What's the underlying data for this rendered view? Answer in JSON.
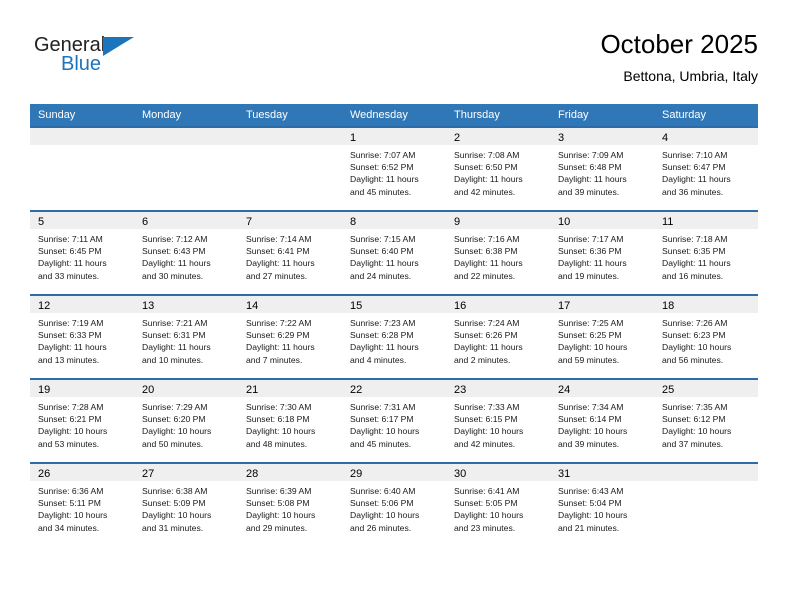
{
  "brand": {
    "name_top": "General",
    "name_bottom": "Blue",
    "accent_color": "#1c75bc",
    "text_color": "#231f20"
  },
  "header": {
    "title": "October 2025",
    "subtitle": "Bettona, Umbria, Italy"
  },
  "theme": {
    "header_row_background": "#3077b7",
    "cell_top_border": "#2c6ca8",
    "daynum_band_background": "#efefef",
    "cell_background": "#ffffff"
  },
  "weekdays": [
    "Sunday",
    "Monday",
    "Tuesday",
    "Wednesday",
    "Thursday",
    "Friday",
    "Saturday"
  ],
  "weeks": [
    [
      {
        "empty": true
      },
      {
        "empty": true
      },
      {
        "empty": true
      },
      {
        "day": "1",
        "sunrise": "Sunrise: 7:07 AM",
        "sunset": "Sunset: 6:52 PM",
        "daylight_1": "Daylight: 11 hours",
        "daylight_2": "and 45 minutes."
      },
      {
        "day": "2",
        "sunrise": "Sunrise: 7:08 AM",
        "sunset": "Sunset: 6:50 PM",
        "daylight_1": "Daylight: 11 hours",
        "daylight_2": "and 42 minutes."
      },
      {
        "day": "3",
        "sunrise": "Sunrise: 7:09 AM",
        "sunset": "Sunset: 6:48 PM",
        "daylight_1": "Daylight: 11 hours",
        "daylight_2": "and 39 minutes."
      },
      {
        "day": "4",
        "sunrise": "Sunrise: 7:10 AM",
        "sunset": "Sunset: 6:47 PM",
        "daylight_1": "Daylight: 11 hours",
        "daylight_2": "and 36 minutes."
      }
    ],
    [
      {
        "day": "5",
        "sunrise": "Sunrise: 7:11 AM",
        "sunset": "Sunset: 6:45 PM",
        "daylight_1": "Daylight: 11 hours",
        "daylight_2": "and 33 minutes."
      },
      {
        "day": "6",
        "sunrise": "Sunrise: 7:12 AM",
        "sunset": "Sunset: 6:43 PM",
        "daylight_1": "Daylight: 11 hours",
        "daylight_2": "and 30 minutes."
      },
      {
        "day": "7",
        "sunrise": "Sunrise: 7:14 AM",
        "sunset": "Sunset: 6:41 PM",
        "daylight_1": "Daylight: 11 hours",
        "daylight_2": "and 27 minutes."
      },
      {
        "day": "8",
        "sunrise": "Sunrise: 7:15 AM",
        "sunset": "Sunset: 6:40 PM",
        "daylight_1": "Daylight: 11 hours",
        "daylight_2": "and 24 minutes."
      },
      {
        "day": "9",
        "sunrise": "Sunrise: 7:16 AM",
        "sunset": "Sunset: 6:38 PM",
        "daylight_1": "Daylight: 11 hours",
        "daylight_2": "and 22 minutes."
      },
      {
        "day": "10",
        "sunrise": "Sunrise: 7:17 AM",
        "sunset": "Sunset: 6:36 PM",
        "daylight_1": "Daylight: 11 hours",
        "daylight_2": "and 19 minutes."
      },
      {
        "day": "11",
        "sunrise": "Sunrise: 7:18 AM",
        "sunset": "Sunset: 6:35 PM",
        "daylight_1": "Daylight: 11 hours",
        "daylight_2": "and 16 minutes."
      }
    ],
    [
      {
        "day": "12",
        "sunrise": "Sunrise: 7:19 AM",
        "sunset": "Sunset: 6:33 PM",
        "daylight_1": "Daylight: 11 hours",
        "daylight_2": "and 13 minutes."
      },
      {
        "day": "13",
        "sunrise": "Sunrise: 7:21 AM",
        "sunset": "Sunset: 6:31 PM",
        "daylight_1": "Daylight: 11 hours",
        "daylight_2": "and 10 minutes."
      },
      {
        "day": "14",
        "sunrise": "Sunrise: 7:22 AM",
        "sunset": "Sunset: 6:29 PM",
        "daylight_1": "Daylight: 11 hours",
        "daylight_2": "and 7 minutes."
      },
      {
        "day": "15",
        "sunrise": "Sunrise: 7:23 AM",
        "sunset": "Sunset: 6:28 PM",
        "daylight_1": "Daylight: 11 hours",
        "daylight_2": "and 4 minutes."
      },
      {
        "day": "16",
        "sunrise": "Sunrise: 7:24 AM",
        "sunset": "Sunset: 6:26 PM",
        "daylight_1": "Daylight: 11 hours",
        "daylight_2": "and 2 minutes."
      },
      {
        "day": "17",
        "sunrise": "Sunrise: 7:25 AM",
        "sunset": "Sunset: 6:25 PM",
        "daylight_1": "Daylight: 10 hours",
        "daylight_2": "and 59 minutes."
      },
      {
        "day": "18",
        "sunrise": "Sunrise: 7:26 AM",
        "sunset": "Sunset: 6:23 PM",
        "daylight_1": "Daylight: 10 hours",
        "daylight_2": "and 56 minutes."
      }
    ],
    [
      {
        "day": "19",
        "sunrise": "Sunrise: 7:28 AM",
        "sunset": "Sunset: 6:21 PM",
        "daylight_1": "Daylight: 10 hours",
        "daylight_2": "and 53 minutes."
      },
      {
        "day": "20",
        "sunrise": "Sunrise: 7:29 AM",
        "sunset": "Sunset: 6:20 PM",
        "daylight_1": "Daylight: 10 hours",
        "daylight_2": "and 50 minutes."
      },
      {
        "day": "21",
        "sunrise": "Sunrise: 7:30 AM",
        "sunset": "Sunset: 6:18 PM",
        "daylight_1": "Daylight: 10 hours",
        "daylight_2": "and 48 minutes."
      },
      {
        "day": "22",
        "sunrise": "Sunrise: 7:31 AM",
        "sunset": "Sunset: 6:17 PM",
        "daylight_1": "Daylight: 10 hours",
        "daylight_2": "and 45 minutes."
      },
      {
        "day": "23",
        "sunrise": "Sunrise: 7:33 AM",
        "sunset": "Sunset: 6:15 PM",
        "daylight_1": "Daylight: 10 hours",
        "daylight_2": "and 42 minutes."
      },
      {
        "day": "24",
        "sunrise": "Sunrise: 7:34 AM",
        "sunset": "Sunset: 6:14 PM",
        "daylight_1": "Daylight: 10 hours",
        "daylight_2": "and 39 minutes."
      },
      {
        "day": "25",
        "sunrise": "Sunrise: 7:35 AM",
        "sunset": "Sunset: 6:12 PM",
        "daylight_1": "Daylight: 10 hours",
        "daylight_2": "and 37 minutes."
      }
    ],
    [
      {
        "day": "26",
        "sunrise": "Sunrise: 6:36 AM",
        "sunset": "Sunset: 5:11 PM",
        "daylight_1": "Daylight: 10 hours",
        "daylight_2": "and 34 minutes."
      },
      {
        "day": "27",
        "sunrise": "Sunrise: 6:38 AM",
        "sunset": "Sunset: 5:09 PM",
        "daylight_1": "Daylight: 10 hours",
        "daylight_2": "and 31 minutes."
      },
      {
        "day": "28",
        "sunrise": "Sunrise: 6:39 AM",
        "sunset": "Sunset: 5:08 PM",
        "daylight_1": "Daylight: 10 hours",
        "daylight_2": "and 29 minutes."
      },
      {
        "day": "29",
        "sunrise": "Sunrise: 6:40 AM",
        "sunset": "Sunset: 5:06 PM",
        "daylight_1": "Daylight: 10 hours",
        "daylight_2": "and 26 minutes."
      },
      {
        "day": "30",
        "sunrise": "Sunrise: 6:41 AM",
        "sunset": "Sunset: 5:05 PM",
        "daylight_1": "Daylight: 10 hours",
        "daylight_2": "and 23 minutes."
      },
      {
        "day": "31",
        "sunrise": "Sunrise: 6:43 AM",
        "sunset": "Sunset: 5:04 PM",
        "daylight_1": "Daylight: 10 hours",
        "daylight_2": "and 21 minutes."
      },
      {
        "empty": true
      }
    ]
  ]
}
